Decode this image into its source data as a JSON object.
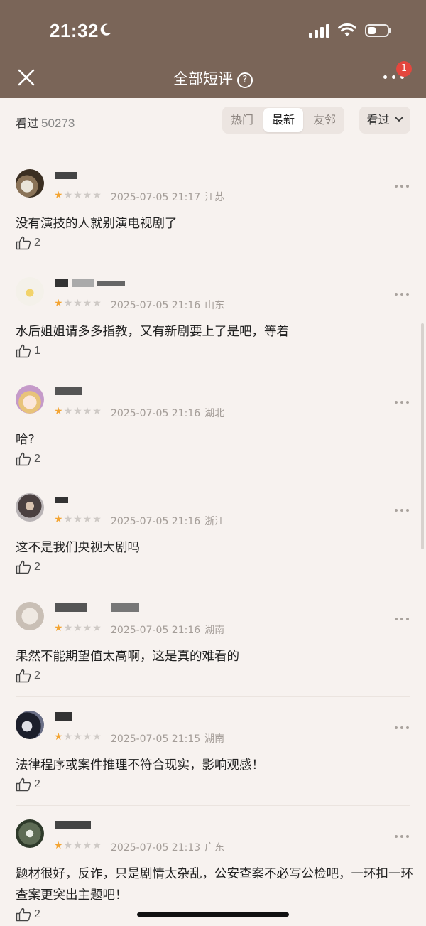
{
  "status_bar": {
    "time": "21:32"
  },
  "nav": {
    "title": "全部短评",
    "help_symbol": "?",
    "badge": "1"
  },
  "filter": {
    "seen_label": "看过",
    "seen_count": "50273",
    "tabs": [
      {
        "label": "热门",
        "active": false
      },
      {
        "label": "最新",
        "active": true
      },
      {
        "label": "友邻",
        "active": false
      }
    ],
    "dropdown_label": "看过"
  },
  "colors": {
    "header_bg": "#7a6558",
    "page_bg": "#f7f2ef",
    "star_on": "#f3a432",
    "star_off": "#cfcac6"
  },
  "comments": [
    {
      "rating": 1,
      "date": "2025-07-05 21:17",
      "location": "江苏",
      "text": "没有演技的人就别演电视剧了",
      "likes": "2"
    },
    {
      "rating": 1,
      "date": "2025-07-05 21:16",
      "location": "山东",
      "text": "水后姐姐请多多指教，又有新剧要上了是吧，等着",
      "likes": "1"
    },
    {
      "rating": 1,
      "date": "2025-07-05 21:16",
      "location": "湖北",
      "text": "哈?",
      "likes": "2"
    },
    {
      "rating": 1,
      "date": "2025-07-05 21:16",
      "location": "浙江",
      "text": "这不是我们央视大剧吗",
      "likes": "2"
    },
    {
      "rating": 1,
      "date": "2025-07-05 21:16",
      "location": "湖南",
      "text": "果然不能期望值太高啊，这是真的难看的",
      "likes": "2"
    },
    {
      "rating": 1,
      "date": "2025-07-05 21:15",
      "location": "湖南",
      "text": "法律程序或案件推理不符合现实，影响观感！",
      "likes": "2"
    },
    {
      "rating": 1,
      "date": "2025-07-05 21:13",
      "location": "广东",
      "text": "题材很好，反诈，只是剧情太杂乱，公安查案不必写公检吧，一环扣一环查案更突出主题吧！",
      "likes": "2"
    }
  ]
}
